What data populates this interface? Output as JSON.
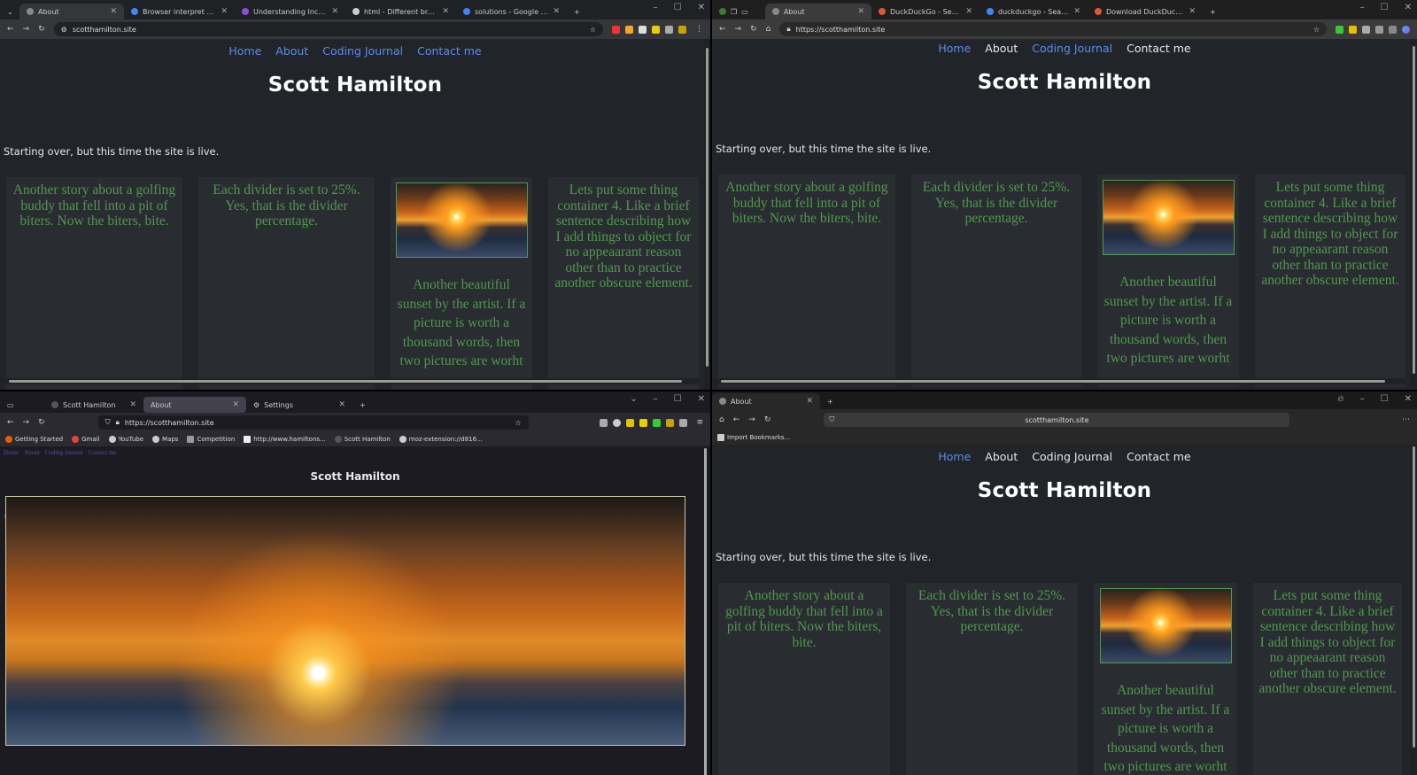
{
  "site": {
    "nav": [
      "Home",
      "About",
      "Coding Journal",
      "Contact me"
    ],
    "title": "Scott Hamilton",
    "intro": "Starting over, but this time the site is live.",
    "col1": "Another story about a golfing buddy that fell into a pit of biters. Now the biters, bite.",
    "col2": "Each divider is set to 25%. Yes, that is the divider percentage.",
    "col3": "Another beautiful sunset by the artist. If a picture is worth a thousand words, then two pictures are worht",
    "col4": "Lets put some thing container 4. Like a brief sentence describing how I add things to object for no appeaarant reason other than to practice another obscure element."
  },
  "q1": {
    "tabs": [
      "About",
      "Browser interpret code differe",
      "Understanding Inconsistent Br",
      "html - Different browsers rend",
      "solutions - Google Search"
    ],
    "url": "scotthamilton.site",
    "new_tab": "+",
    "close": "✕"
  },
  "q2": {
    "tabs": [
      "About",
      "DuckDuckGo - Search",
      "duckduckgo - Search",
      "Download DuckDuckGo for Wind"
    ],
    "url": "https://scotthamilton.site",
    "new_tab": "+",
    "close": "✕"
  },
  "q3": {
    "tabs": [
      "Scott Hamilton",
      "About",
      "Settings"
    ],
    "url": "https://scotthamilton.site",
    "bookmarks": [
      "Getting Started",
      "Gmail",
      "YouTube",
      "Maps",
      "Competition",
      "http://www.hamiltons...",
      "Scott Hamilton",
      "moz-extension://d816..."
    ],
    "raw_nav": [
      "Home",
      "About",
      "Coding Journal",
      "Contact me"
    ],
    "new_tab": "+",
    "close": "✕"
  },
  "q4": {
    "tabs": [
      "About"
    ],
    "url": "scotthamilton.site",
    "bookmarks": [
      "Import Bookmarks..."
    ],
    "new_tab": "+",
    "close": "✕"
  },
  "colors": {
    "page_bg": "#212428",
    "nav_link": "#5b8cf0",
    "body_text": "#4f9a4c"
  }
}
